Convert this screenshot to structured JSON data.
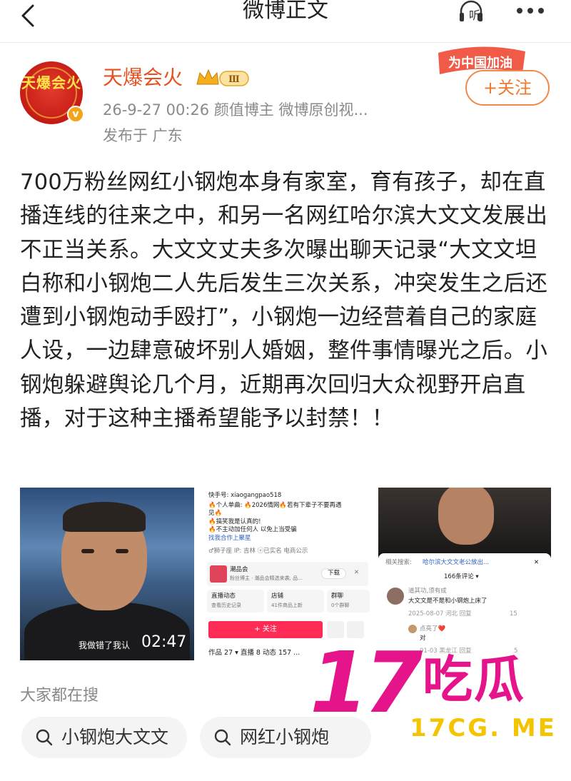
{
  "nav": {
    "title": "微博正文",
    "listen_label": "听"
  },
  "author": {
    "name": "天爆会火",
    "avatar_text": "天爆会火",
    "level": "Ⅲ",
    "meta": "26-9-27 00:26  颜值博主  微博原创视...",
    "location": "发布于 广东",
    "badge_text": "为中国加油",
    "follow_label": "+关注"
  },
  "post": {
    "text": "700万粉丝网红小钢炮本身有家室，育有孩子，却在直播连线的往来之中，和另一名网红哈尔滨大文文发展出不正当关系。大文文丈夫多次曝出聊天记录“大文文坦白称和小钢炮二人先后发生三次关系，冲突发生之后还遭到小钢炮动手殴打”，小钢炮一边经营着自己的家庭人设，一边肆意破坏别人婚姻，整件事情曝光之后。小钢炮躲避舆论几个月，近期再次回归大众视野开启直播，对于这种主播希望能予以封禁！！"
  },
  "image1": {
    "caption": "我做错了我认",
    "duration": "02:47"
  },
  "image2": {
    "handle": "快手号: xiaogangpao518",
    "bio1": "🔥个人单曲: 🔥2026情网🔥若有下辈子不要再遇",
    "bio2": "见🔥",
    "bio3": "🔥搞笑我是认真的!",
    "bio4": "🔥不主动加任何人 以免上当受骗",
    "bio5": "找我合作上聚星",
    "tags": "♂狮子座  IP: 吉林  ⓥ已实名  电商公示",
    "shop_name": "潮品会",
    "shop_sub": "粉丝博主 · 潮品会精选来袭, 品...",
    "download": "下载",
    "live": "直播动态",
    "live_sub": "查看历史记录",
    "store": "店铺",
    "store_sub": "41件商品上新",
    "group": "群聊",
    "group_sub": "0个群聊",
    "follow": "+ 关注",
    "tabs": "作品 27 ▾    直播 8    动态 157    ..."
  },
  "image3": {
    "search_label": "相关搜索:",
    "search_link": "哈尔滨大文文老公放出...",
    "comment_count": "166条评论 ▾",
    "c1_user": "道其功,须有成",
    "c1_text": "大文文是不是和小钢炮上床了",
    "c1_meta": "2025-08-07 河北   回复",
    "c1_likes": "15",
    "c2_user": "点亮了❤️",
    "c2_text": "对",
    "c2_meta": "01-03 黑龙江   回复",
    "c2_likes": "5"
  },
  "search": {
    "title": "大家都在搜",
    "chip1": "小钢炮大文文",
    "chip2": "网红小钢炮"
  },
  "watermark": {
    "number": "17",
    "cn": "吃瓜",
    "url": "17CG. ME"
  }
}
